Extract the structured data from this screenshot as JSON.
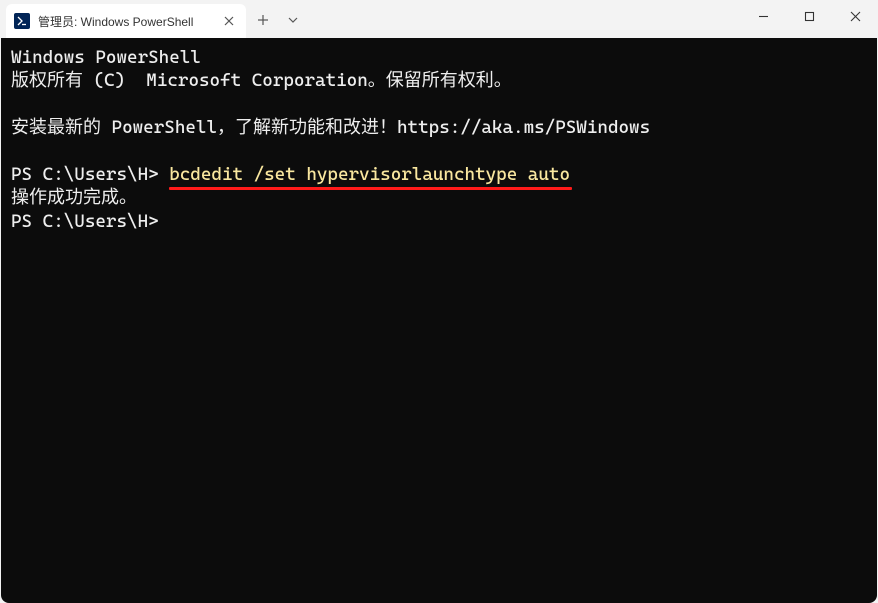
{
  "tab": {
    "title": "管理员: Windows PowerShell"
  },
  "terminal": {
    "line1": "Windows PowerShell",
    "line2": "版权所有 (C)  Microsoft Corporation。保留所有权利。",
    "line3": "安装最新的 PowerShell，了解新功能和改进！https://aka.ms/PSWindows",
    "prompt1": "PS C:\\Users\\H> ",
    "command": "bcdedit /set hypervisorlaunchtype auto",
    "result": "操作成功完成。",
    "prompt2": "PS C:\\Users\\H>"
  }
}
